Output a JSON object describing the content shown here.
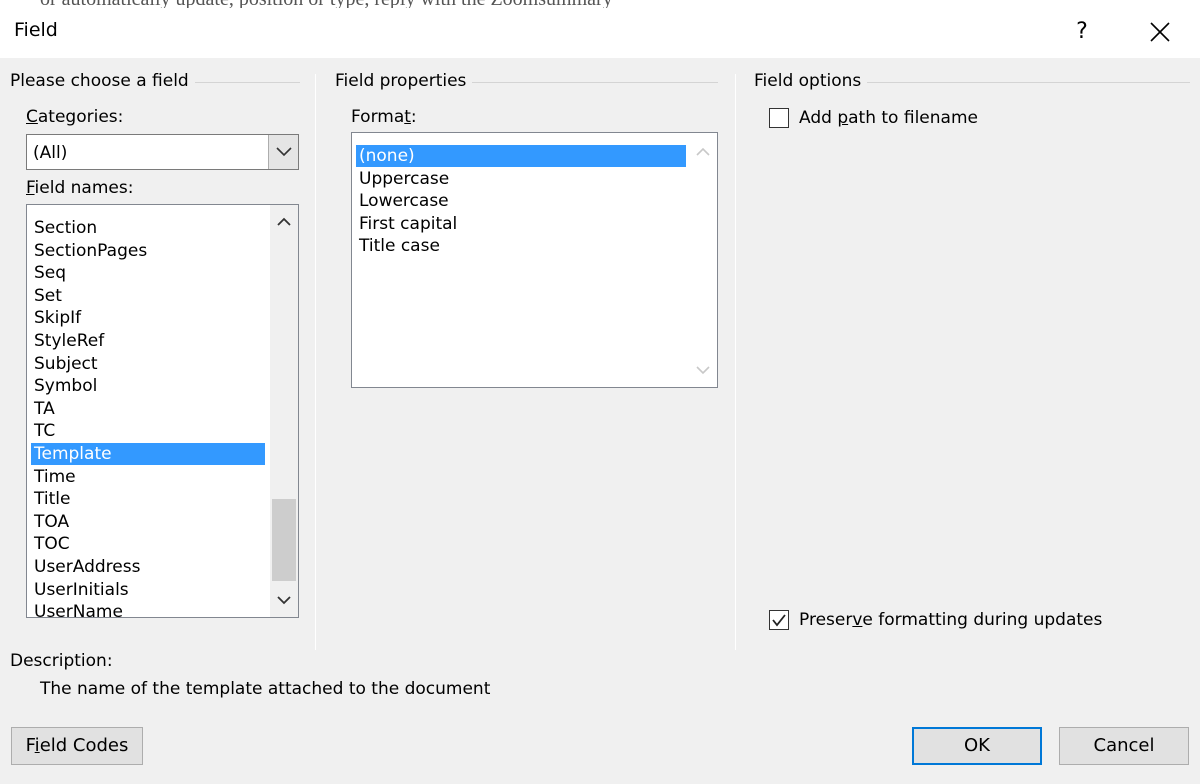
{
  "window": {
    "title": "Field",
    "help_label": "?"
  },
  "background_text": "or automatically update, position or type, reply with the Zoomsummary",
  "choose_field": {
    "section_title": "Please choose a field",
    "categories_label_pre": "",
    "categories_label_key": "C",
    "categories_label_post": "ategories:",
    "categories_value": "(All)",
    "field_names_label_key": "F",
    "field_names_label_post": "ield names:",
    "field_names": [
      {
        "label": "Section",
        "selected": false
      },
      {
        "label": "SectionPages",
        "selected": false
      },
      {
        "label": "Seq",
        "selected": false
      },
      {
        "label": "Set",
        "selected": false
      },
      {
        "label": "SkipIf",
        "selected": false
      },
      {
        "label": "StyleRef",
        "selected": false
      },
      {
        "label": "Subject",
        "selected": false
      },
      {
        "label": "Symbol",
        "selected": false
      },
      {
        "label": "TA",
        "selected": false
      },
      {
        "label": "TC",
        "selected": false
      },
      {
        "label": "Template",
        "selected": true
      },
      {
        "label": "Time",
        "selected": false
      },
      {
        "label": "Title",
        "selected": false
      },
      {
        "label": "TOA",
        "selected": false
      },
      {
        "label": "TOC",
        "selected": false
      },
      {
        "label": "UserAddress",
        "selected": false
      },
      {
        "label": "UserInitials",
        "selected": false
      },
      {
        "label": "UserName",
        "selected": false
      }
    ]
  },
  "field_properties": {
    "section_title": "Field properties",
    "format_label_pre": "Forma",
    "format_label_key": "t",
    "format_label_post": ":",
    "formats": [
      {
        "label": "(none)",
        "selected": true
      },
      {
        "label": "Uppercase",
        "selected": false
      },
      {
        "label": "Lowercase",
        "selected": false
      },
      {
        "label": "First capital",
        "selected": false
      },
      {
        "label": "Title case",
        "selected": false
      }
    ]
  },
  "field_options": {
    "section_title": "Field options",
    "add_path_pre": "Add ",
    "add_path_key": "p",
    "add_path_post": "ath to filename",
    "add_path_checked": false,
    "preserve_pre": "Preser",
    "preserve_key": "v",
    "preserve_post": "e formatting during updates",
    "preserve_checked": true
  },
  "description": {
    "label": "Description:",
    "text": "The name of the template attached to the document"
  },
  "buttons": {
    "field_codes_pre": "F",
    "field_codes_key": "i",
    "field_codes_post": "eld Codes",
    "ok": "OK",
    "cancel": "Cancel"
  }
}
